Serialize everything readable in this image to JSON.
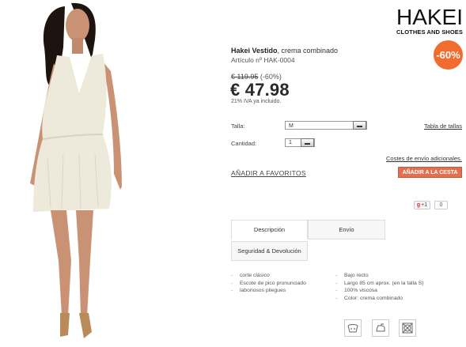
{
  "brand": {
    "name": "HAKEI",
    "tagline": "CLOTHES AND SHOES"
  },
  "badge": {
    "discount": "-60%",
    "color": "#f26c2f"
  },
  "product": {
    "brand": "Hakei Vestido",
    "variant": ", crema combinado",
    "article": "Artículo nº HAK-0004",
    "old_price": "€ 119.95",
    "discount_text": " (-60%)",
    "price": "€ 47.98",
    "vat_note": "21% IVA ya incluido."
  },
  "form": {
    "size_label": "Talla:",
    "size_value": "M",
    "size_chart_link": "Tabla de tallas",
    "qty_label": "Cantidad:",
    "qty_value": "1",
    "shipping_link": "Costes de envío adicionales.",
    "favorites_link": "AÑADIR A FAVORITOS",
    "cart_button": "AÑADIR A LA CESTA",
    "cart_color": "#e2704f"
  },
  "social": {
    "gplus_label": "+1",
    "gplus_g": "g",
    "count": "0"
  },
  "tabs": [
    {
      "label": "Descripción",
      "active": true
    },
    {
      "label": "Envío",
      "active": false
    },
    {
      "label": "Seguridad & Devolución",
      "active": false
    }
  ],
  "features_left": [
    "corte clásico",
    "Escote de pico pronunciado",
    "laboriosos pliegues"
  ],
  "features_right": [
    "Bajo recto",
    "Largo 85 cm aprox. (en la talla S)",
    "100% viscosa",
    "Color: crema combinado"
  ],
  "care_icons": [
    "wash-30-icon",
    "iron-icon",
    "no-tumble-dry-icon"
  ]
}
